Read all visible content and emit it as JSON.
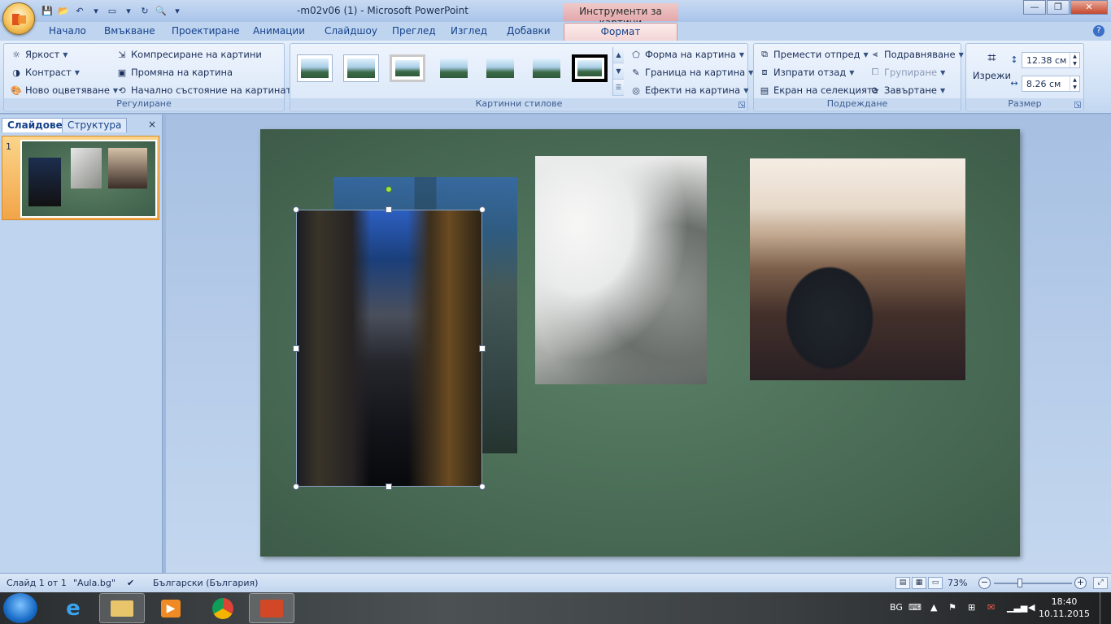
{
  "titlebar": {
    "title": "-m02v06 (1) - Microsoft PowerPoint",
    "context_title": "Инструменти за картини"
  },
  "tabs": [
    "Начало",
    "Вмъкване",
    "Проектиране",
    "Анимации",
    "Слайдшоу",
    "Преглед",
    "Изглед",
    "Добавки"
  ],
  "active_tab": "Формат",
  "ribbon": {
    "adjust": {
      "label": "Регулиране",
      "brightness": "Яркост",
      "contrast": "Контраст",
      "recolor": "Ново оцветяване",
      "compress": "Компресиране на картини",
      "change": "Промяна на картина",
      "reset": "Начално състояние на картината"
    },
    "styles": {
      "label": "Картинни стилове",
      "shape": "Форма на картина",
      "border": "Граница на картина",
      "effects": "Ефекти на картина"
    },
    "arrange": {
      "label": "Подреждане",
      "bring_forward": "Премести отпред",
      "send_backward": "Изпрати отзад",
      "selection_pane": "Екран на селекцията",
      "align": "Подравняване",
      "group": "Групиране",
      "rotate": "Завъртане"
    },
    "size": {
      "label": "Размер",
      "crop": "Изрежи",
      "height": "12.38 см",
      "width": "8.26 см"
    }
  },
  "leftpane": {
    "tab_slides": "Слайдове",
    "tab_outline": "Структура",
    "close": "×",
    "slide_number": "1"
  },
  "statusbar": {
    "slide_info": "Слайд 1 от 1",
    "theme": "\"Aula.bg\"",
    "language": "Български (България)",
    "zoom": "73%"
  },
  "taskbar": {
    "language": "BG",
    "time": "18:40",
    "date": "10.11.2015"
  },
  "colors": {
    "slide_bg": "#4a6b55",
    "ribbon_bg": "#cfe0f5",
    "context_tab": "#e3a8ab"
  }
}
